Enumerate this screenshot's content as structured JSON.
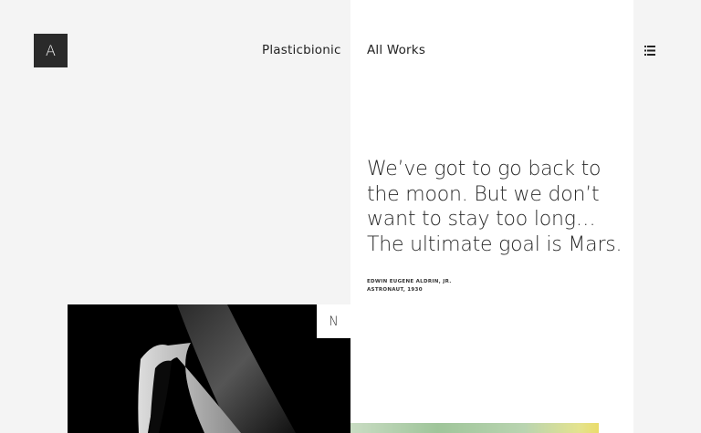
{
  "header": {
    "logo_letter": "A",
    "nav": [
      {
        "label": "Plasticbionic"
      },
      {
        "label": "All Works"
      }
    ],
    "menu_icon": "list-icon"
  },
  "quote": {
    "text": "We’ve got to go back to the moon. But we don’t want to stay too long… The ultimate goal is Mars.",
    "author_name": "EDWIN EUGENE ALDRIN, JR.",
    "author_title": "ASTRONAUT, 1930"
  },
  "gallery": {
    "tag_letter": "N"
  },
  "colors": {
    "background": "#f4f4f4",
    "panel": "#ffffff",
    "logo_bg": "#2a2a2a"
  }
}
